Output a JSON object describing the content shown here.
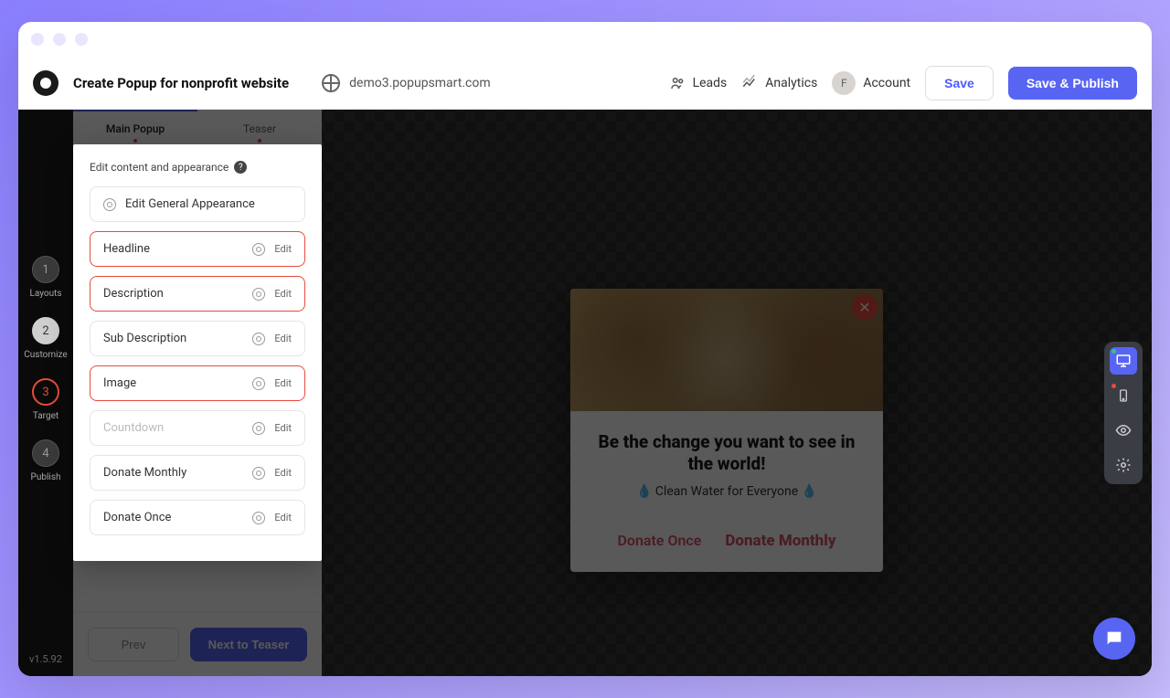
{
  "header": {
    "title": "Create Popup for nonprofit website",
    "url": "demo3.popupsmart.com",
    "nav": {
      "leads": "Leads",
      "analytics": "Analytics",
      "account": "Account",
      "avatar_letter": "F"
    },
    "buttons": {
      "save": "Save",
      "publish": "Save & Publish"
    }
  },
  "steps": [
    {
      "num": "1",
      "label": "Layouts"
    },
    {
      "num": "2",
      "label": "Customize"
    },
    {
      "num": "3",
      "label": "Target"
    },
    {
      "num": "4",
      "label": "Publish"
    }
  ],
  "version": "v1.5.92",
  "tabs": {
    "main": "Main Popup",
    "teaser": "Teaser"
  },
  "panel": {
    "heading": "Edit content and appearance",
    "general": "Edit General Appearance",
    "edit": "Edit",
    "rows": {
      "headline": "Headline",
      "description": "Description",
      "sub_description": "Sub Description",
      "image": "Image",
      "countdown": "Countdown",
      "donate_monthly": "Donate Monthly",
      "donate_once": "Donate Once"
    },
    "prev": "Prev",
    "next": "Next to Teaser"
  },
  "popup": {
    "headline": "Be the change you want to see in the world!",
    "subline": "💧 Clean Water for Everyone 💧",
    "donate_once": "Donate Once",
    "donate_monthly": "Donate Monthly"
  }
}
